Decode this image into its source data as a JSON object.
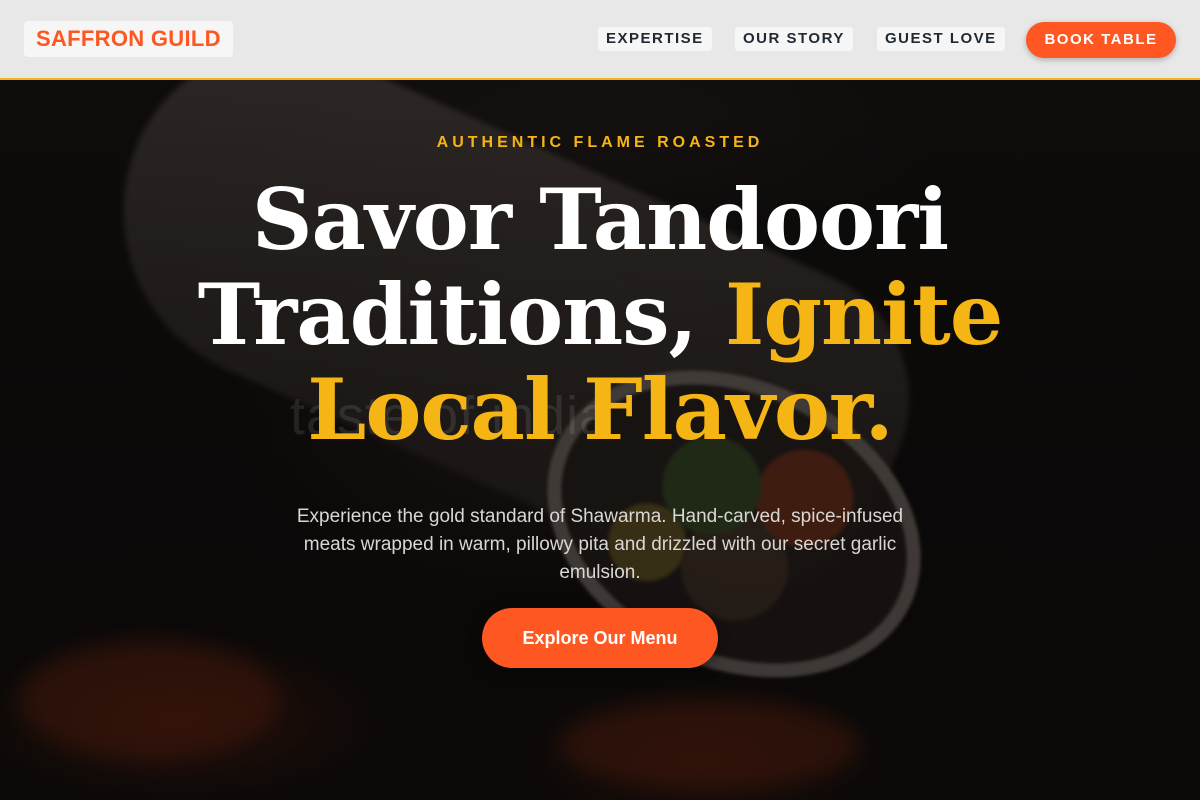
{
  "brand": {
    "name": "SAFFRON GUILD",
    "accent_color": "#ff5722",
    "highlight_color": "#f5b514"
  },
  "nav": {
    "links": [
      {
        "label": "EXPERTISE"
      },
      {
        "label": "OUR STORY"
      },
      {
        "label": "GUEST LOVE"
      }
    ],
    "cta_label": "BOOK TABLE"
  },
  "hero": {
    "eyebrow": "AUTHENTIC FLAME ROASTED",
    "headline_white": "Savor Tandoori Traditions, ",
    "headline_accent": "Ignite Local Flavor.",
    "ghost_text": "taste of india",
    "description": "Experience the gold standard of Shawarma. Hand-carved, spice-infused meats wrapped in warm, pillowy pita and drizzled with our secret garlic emulsion.",
    "cta_label": "Explore Our Menu"
  }
}
